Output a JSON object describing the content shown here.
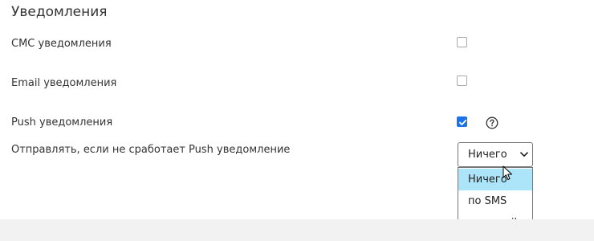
{
  "section": {
    "title": "Уведомления"
  },
  "settings": [
    {
      "label": "СМС уведомления",
      "checked": false
    },
    {
      "label": "Email уведомления",
      "checked": false
    },
    {
      "label": "Push уведомления",
      "checked": true
    }
  ],
  "fallback": {
    "label": "Отправлять, если не сработает Push уведомление",
    "selected": "Ничего",
    "options": [
      "Ничего",
      "по SMS",
      "по e-mail"
    ],
    "highlighted": "Ничего"
  },
  "colors": {
    "checkbox_checked": "#1a73e8",
    "option_highlight": "#ace4f9",
    "footer_band": "#f2f2f2"
  },
  "icons": {
    "help": "question-circle-icon",
    "checkmark": "checkmark-icon",
    "chevron": "chevron-down-icon",
    "cursor": "mouse-cursor-icon"
  }
}
